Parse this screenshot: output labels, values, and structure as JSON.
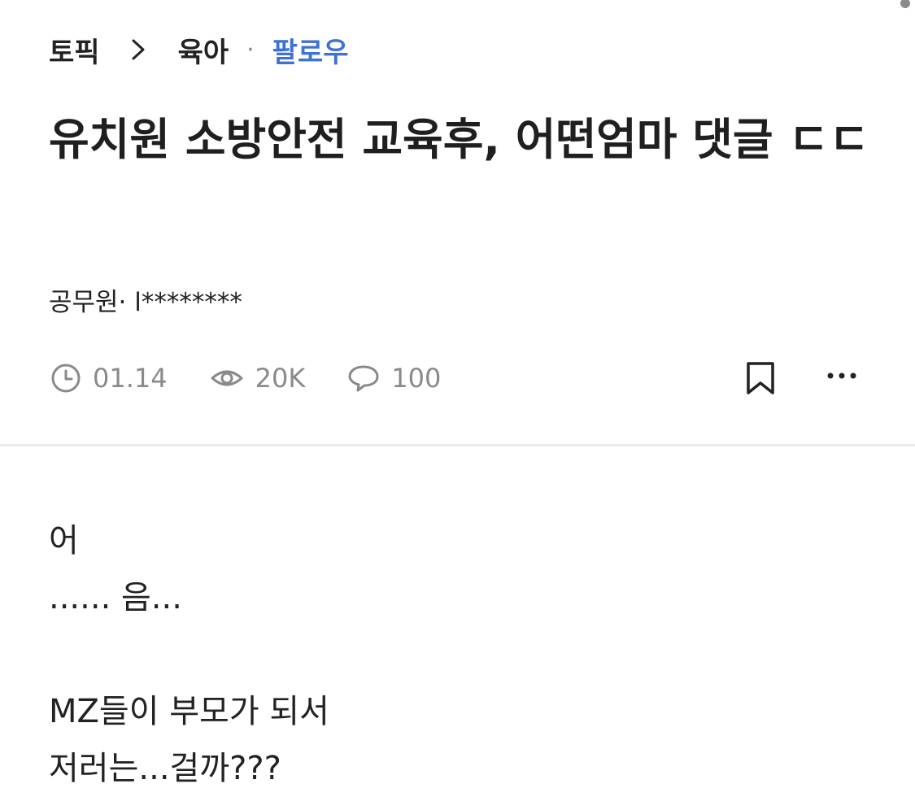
{
  "breadcrumb": {
    "root": "토픽",
    "category": "육아",
    "separator": "·",
    "follow_label": "팔로우"
  },
  "post": {
    "title": "유치원 소방안전 교육후, 어떤엄마 댓글 ㄷㄷ",
    "author": "공무원· l********",
    "date": "01.14",
    "views": "20K",
    "comments": "100",
    "body_lines": [
      "어",
      "...... 음...",
      "",
      "MZ들이 부모가 되서",
      "저러는...걸까???"
    ]
  },
  "icons": {
    "chevron": "chevron-right-icon",
    "date": "clock-icon",
    "views": "eye-icon",
    "comments": "speech-bubble-icon",
    "bookmark": "bookmark-icon",
    "more": "more-horizontal-icon"
  },
  "colors": {
    "accent": "#3d72d6",
    "meta_gray": "#8a8a8a",
    "text": "#222222",
    "divider": "#ebebeb"
  }
}
